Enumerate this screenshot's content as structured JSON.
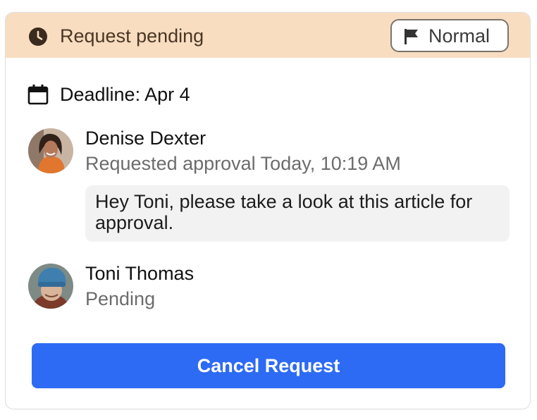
{
  "status": {
    "icon": "clock-icon",
    "title": "Request pending",
    "background_color": "#f8ddc0"
  },
  "priority": {
    "icon": "flag-icon",
    "label": "Normal"
  },
  "deadline": {
    "icon": "calendar-icon",
    "text": "Deadline: Apr 4"
  },
  "requester": {
    "name": "Denise Dexter",
    "action": "Requested approval Today, 10:19 AM",
    "message": "Hey Toni, please take a look at this article for approval."
  },
  "approver": {
    "name": "Toni Thomas",
    "status": "Pending"
  },
  "cancel_button": {
    "label": "Cancel Request",
    "color": "#2d6bf4"
  }
}
